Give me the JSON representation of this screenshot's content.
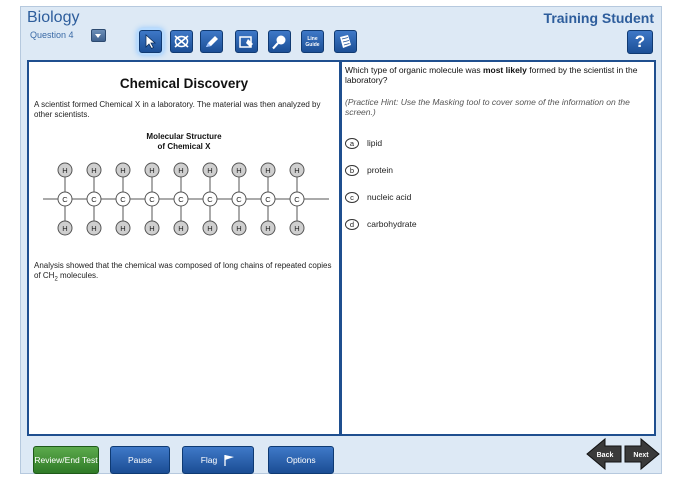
{
  "header": {
    "subject": "Biology",
    "question_label": "Question 4",
    "student_name": "Training Student"
  },
  "toolbar": {
    "tools": [
      "pointer",
      "option-eliminator",
      "highlighter",
      "masking",
      "magnifier",
      "line-guide",
      "notepad"
    ],
    "line_guide_label_1": "Line",
    "line_guide_label_2": "Guide",
    "help_label": "?"
  },
  "passage": {
    "title": "Chemical Discovery",
    "intro": "A scientist formed Chemical X in a laboratory. The material was then analyzed by other scientists.",
    "figure_title_line1": "Molecular Structure",
    "figure_title_line2": "of Chemical X",
    "atom_hydrogen": "H",
    "atom_carbon": "C",
    "conclusion_prefix": "Analysis showed that the chemical was composed of long chains of repeated copies of CH",
    "conclusion_subscript": "2",
    "conclusion_suffix": " molecules."
  },
  "question": {
    "stem_prefix": "Which type of organic molecule was ",
    "stem_bold": "most likely",
    "stem_suffix": " formed by the scientist in the laboratory?",
    "hint": "(Practice Hint: Use the Masking tool to cover some of the information on the screen.)",
    "options": [
      {
        "letter": "a",
        "text": "lipid"
      },
      {
        "letter": "b",
        "text": "protein"
      },
      {
        "letter": "c",
        "text": "nucleic acid"
      },
      {
        "letter": "d",
        "text": "carbohydrate"
      }
    ]
  },
  "footer": {
    "review_label": "Review/End Test",
    "pause_label": "Pause",
    "flag_label": "Flag",
    "options_label": "Options",
    "back_label": "Back",
    "next_label": "Next"
  },
  "colors": {
    "panel_border": "#1f4f8f",
    "header_text": "#2d5d9c",
    "button_blue": "#2a5fa8",
    "button_green": "#3f8f35"
  }
}
